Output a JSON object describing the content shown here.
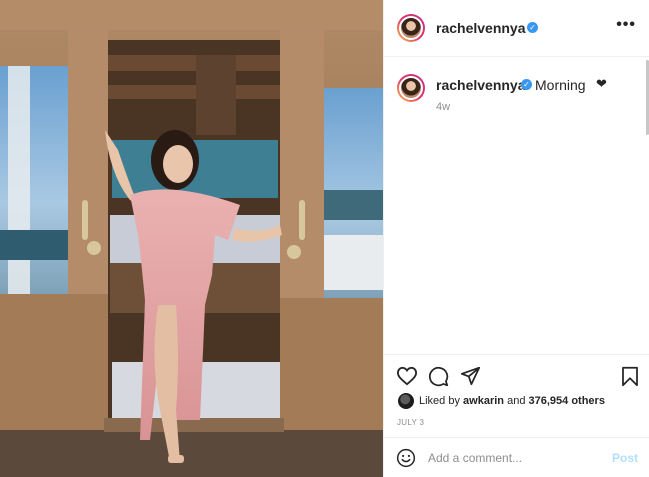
{
  "post": {
    "image_alt": "Woman in pink dress standing in wooden cabin doorway",
    "header": {
      "username": "rachelvennya",
      "verified": true,
      "more_icon": "more-horizontal-icon"
    },
    "caption": {
      "username": "rachelvennya",
      "text": "Morning",
      "emoji": "❤",
      "time_ago": "4w"
    },
    "actions": {
      "icons": [
        "heart-icon",
        "comment-icon",
        "share-icon",
        "bookmark-icon"
      ]
    },
    "likes": {
      "prefix": "Liked by",
      "liker": "awkarin",
      "joiner": "and",
      "count": "376,954",
      "suffix": "others"
    },
    "date": "JULY 3",
    "comment": {
      "placeholder": "Add a comment...",
      "post_label": "Post",
      "emoji_icon": "smiley-icon"
    }
  },
  "colors": {
    "accent": "#3897f0",
    "post_disabled": "#b2dffc",
    "muted": "#8e8e8e",
    "dress": "#e8a6a8",
    "wood": "#a57a56"
  }
}
